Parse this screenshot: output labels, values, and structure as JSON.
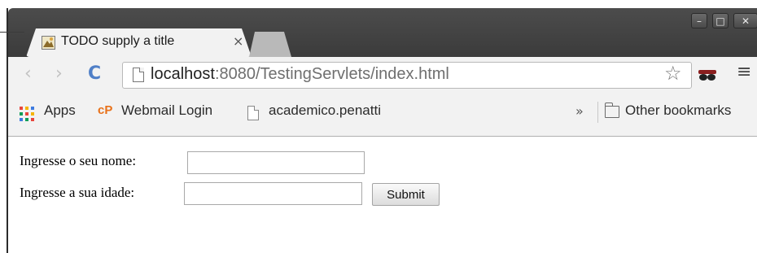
{
  "browser": {
    "tab": {
      "title": "TODO supply a title",
      "close_glyph": "×"
    },
    "window_controls": {
      "minimize": "–",
      "maximize": "□",
      "close": "✕"
    },
    "toolbar": {
      "back_glyph": "‹",
      "forward_glyph": "›",
      "reload_glyph": "C",
      "url_host": "localhost",
      "url_rest": ":8080/TestingServlets/index.html",
      "star_glyph": "☆",
      "menu_glyph": "≡"
    },
    "bookmarks": {
      "apps": "Apps",
      "cp_logo": "cP",
      "webmail": "Webmail Login",
      "academico": "academico.penatti",
      "overflow": "»",
      "other": "Other bookmarks"
    }
  },
  "page": {
    "name_label": "Ingresse o seu nome:",
    "name_value": "",
    "age_label": "Ingresse a sua idade:",
    "age_value": "",
    "submit_label": "Submit"
  },
  "colors": {
    "frame": "#3b3b3b",
    "tab_active": "#f2f2f2",
    "reload_accent": "#4f7fc7",
    "cpanel_orange": "#e8711a"
  },
  "icons": [
    "page-icon",
    "star-icon",
    "extension-icon",
    "menu-icon",
    "apps-grid-icon",
    "cpanel-icon",
    "document-icon",
    "folder-icon"
  ]
}
